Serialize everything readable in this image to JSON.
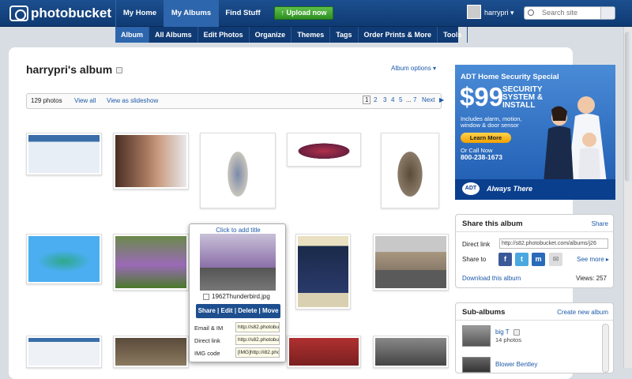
{
  "header": {
    "logo_text": "photobucket",
    "nav": [
      {
        "label": "My Home"
      },
      {
        "label": "My Albums"
      },
      {
        "label": "Find Stuff"
      }
    ],
    "upload_label": "Upload now",
    "username": "harrypri",
    "search_placeholder": "Search site"
  },
  "subnav": [
    "Album",
    "All Albums",
    "Edit Photos",
    "Organize",
    "Themes",
    "Tags",
    "Order Prints & More",
    "Tools"
  ],
  "album": {
    "title": "harrypri's album",
    "options_label": "Album options",
    "photo_count": "129 photos",
    "view_all": "View all",
    "slideshow": "View as slideshow",
    "pages": [
      "1",
      "2",
      "3",
      "4",
      "5",
      "...",
      "7"
    ],
    "next": "Next"
  },
  "popup": {
    "title": "Click to add title",
    "filename": "1962Thunderbird.jpg",
    "actions": "Share | Edit | Delete | Move",
    "rows": [
      {
        "label": "Email & IM",
        "value": "http://s82.photobuc"
      },
      {
        "label": "Direct link",
        "value": "http://s82.photobuc"
      },
      {
        "label": "IMG code",
        "value": "[IMG]http://i82.phot"
      }
    ]
  },
  "ad": {
    "heading": "ADT Home Security Special",
    "price": "$99",
    "tagline": "SECURITY SYSTEM & INSTALL",
    "includes": "Includes alarm, motion, window & door sensor",
    "learn_more": "Learn More",
    "call_text": "Or Call Now",
    "phone": "800-238-1673",
    "logo": "ADT",
    "slogan": "Always There"
  },
  "share_panel": {
    "title": "Share this album",
    "share_link": "Share",
    "direct_label": "Direct link",
    "direct_value": "http://s82.photobucket.com/albums/j26",
    "share_to": "Share to",
    "see_more": "See more",
    "download": "Download this album",
    "views": "Views: 257"
  },
  "subalbums": {
    "title": "Sub-albums",
    "create": "Create new album",
    "items": [
      {
        "name": "big T",
        "count": "14 photos"
      },
      {
        "name": "Blower Bentley",
        "count": ""
      }
    ]
  }
}
